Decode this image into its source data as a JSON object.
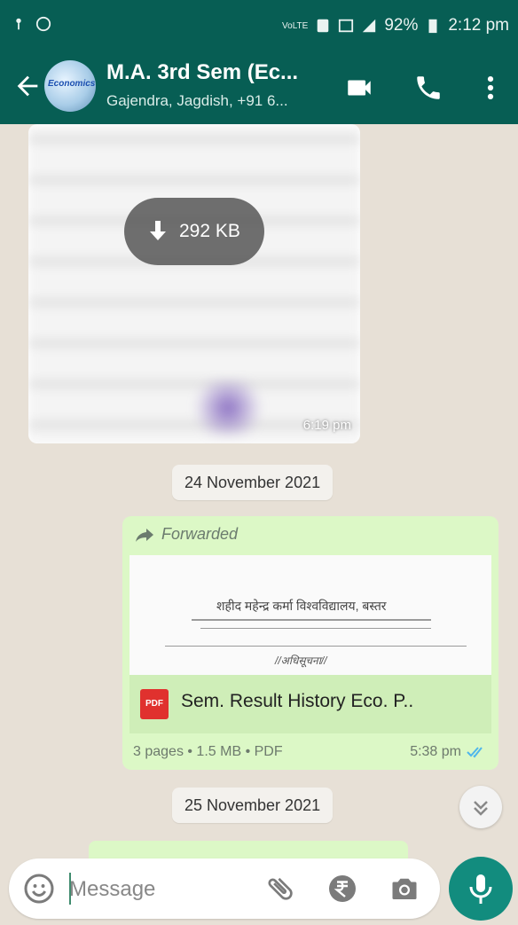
{
  "status_bar": {
    "battery": "92%",
    "time": "2:12 pm"
  },
  "header": {
    "group_name": "M.A. 3rd Sem (Ec...",
    "members": "Gajendra, Jagdish, +91 6...",
    "avatar_text": "Economics"
  },
  "messages": {
    "image_message": {
      "download_size": "292 KB",
      "time": "6:19 pm"
    },
    "date_1": "24 November 2021",
    "document_message": {
      "forwarded_label": "Forwarded",
      "file_name": "Sem. Result  History Eco. P..",
      "meta": "3 pages • 1.5 MB • PDF",
      "time": "5:38 pm",
      "pdf_label": "PDF",
      "preview_heading": "शहीद महेन्द्र कर्मा विश्वविद्यालय, बस्तर",
      "preview_ref": "//अधिसूचना//"
    },
    "date_2": "25 November 2021"
  },
  "composer": {
    "placeholder": "Message"
  },
  "colors": {
    "header": "#075e54",
    "outgoing_bubble": "#dcf8c6",
    "mic_button": "#128c7e",
    "chat_background": "#e7e0d6"
  }
}
